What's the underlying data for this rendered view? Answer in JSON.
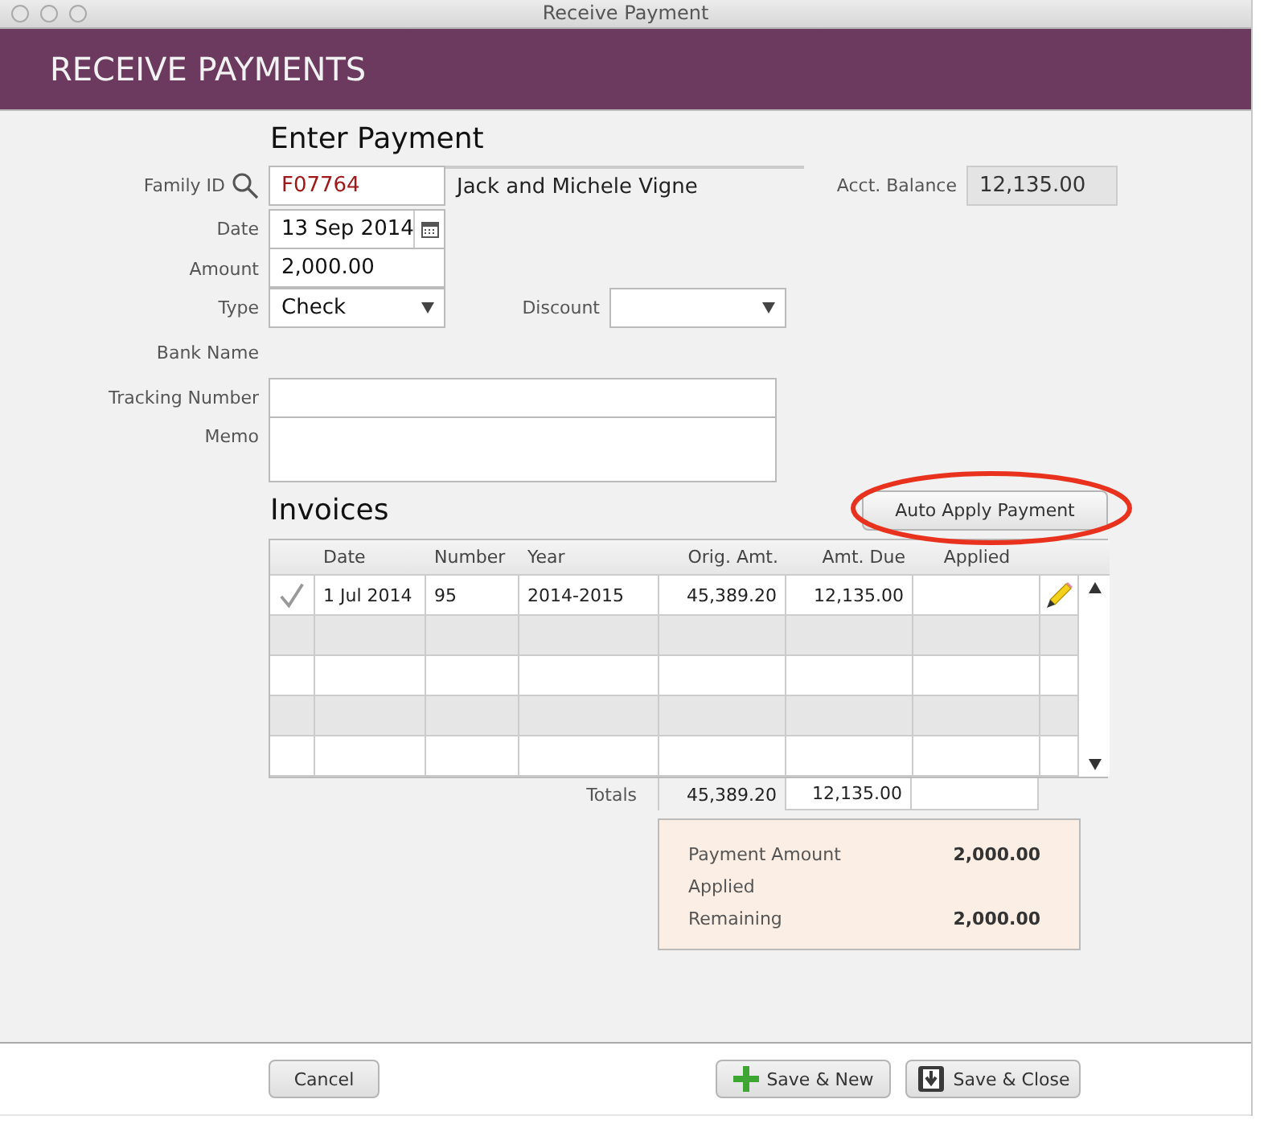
{
  "window": {
    "title": "Receive Payment"
  },
  "header": {
    "title": "RECEIVE PAYMENTS"
  },
  "payment": {
    "heading": "Enter Payment",
    "family_id": {
      "label": "Family ID",
      "value": "F07764"
    },
    "family_name": "Jack and Michele Vigne",
    "acct_balance": {
      "label": "Acct. Balance",
      "value": "12,135.00"
    },
    "date": {
      "label": "Date",
      "value": "13 Sep 2014"
    },
    "amount": {
      "label": "Amount",
      "value": "2,000.00"
    },
    "type": {
      "label": "Type",
      "value": "Check"
    },
    "discount": {
      "label": "Discount"
    },
    "bank_name": {
      "label": "Bank Name"
    },
    "tracking_number": {
      "label": "Tracking Number"
    },
    "memo": {
      "label": "Memo"
    }
  },
  "invoices": {
    "heading": "Invoices",
    "auto_apply_button": {
      "label": "Auto Apply Payment",
      "circled": true
    },
    "columns": [
      "Date",
      "Number",
      "Year",
      "Orig. Amt.",
      "Amt. Due",
      "Applied"
    ],
    "rows": [
      {
        "checked": true,
        "date": "1 Jul 2014",
        "number": "95",
        "year": "2014-2015",
        "orig_amt": "45,389.20",
        "amt_due": "12,135.00"
      }
    ],
    "totals": {
      "label": "Totals",
      "orig_amt": "45,389.20",
      "amt_due": "12,135.00"
    }
  },
  "summary": [
    {
      "label": "Payment Amount",
      "value": "2,000.00"
    },
    {
      "label": "Applied"
    },
    {
      "label": "Remaining",
      "value": "2,000.00"
    }
  ],
  "footer_buttons": [
    {
      "kind": "plain",
      "label": "Cancel"
    },
    {
      "kind": "add",
      "label": "Save & New"
    },
    {
      "kind": "save",
      "label": "Save & Close"
    }
  ]
}
